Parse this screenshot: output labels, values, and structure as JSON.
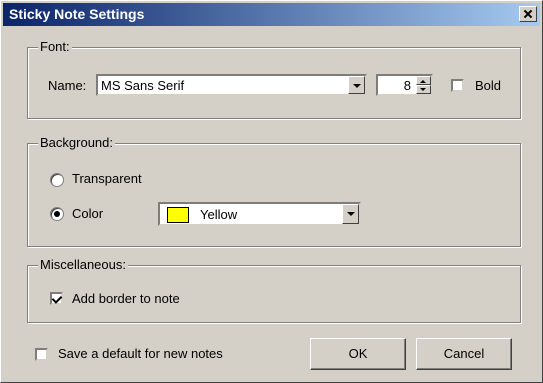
{
  "window": {
    "title": "Sticky Note Settings"
  },
  "font": {
    "group_label": "Font:",
    "name_label": "Name:",
    "name_value": "MS Sans Serif",
    "size_value": "8",
    "bold_label": "Bold",
    "bold_checked": false
  },
  "background": {
    "group_label": "Background:",
    "transparent_label": "Transparent",
    "color_label": "Color",
    "selected": "Color",
    "color_value": "Yellow",
    "swatch_color": "#ffff00"
  },
  "misc": {
    "group_label": "Miscellaneous:",
    "border_label": "Add border to note",
    "border_checked": true
  },
  "footer": {
    "default_label": "Save a default for new notes",
    "default_checked": false,
    "ok_label": "OK",
    "cancel_label": "Cancel"
  }
}
